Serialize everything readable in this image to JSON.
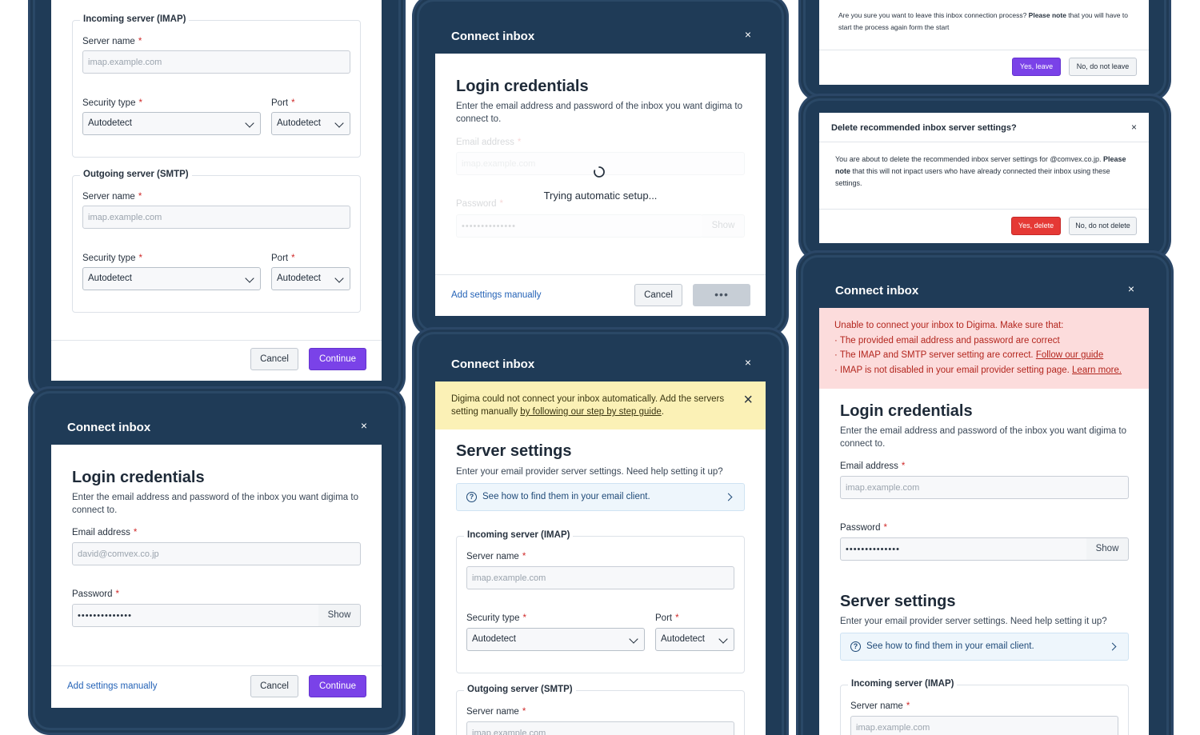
{
  "panel_a": {
    "imap_legend": "Incoming server (IMAP)",
    "smtp_legend": "Outgoing server (SMTP)",
    "server_name_label": "Server name",
    "server_name_placeholder": "imap.example.com",
    "security_type_label": "Security type",
    "security_type_value": "Autodetect",
    "port_label": "Port",
    "port_value": "Autodetect",
    "cancel": "Cancel",
    "continue": "Continue"
  },
  "panel_b": {
    "title": "Connect inbox",
    "heading": "Login credentials",
    "subtitle": "Enter the email address and password of the inbox you want digima to connect to.",
    "email_label": "Email address",
    "email_placeholder": "david@comvex.co.jp",
    "password_label": "Password",
    "password_value": "••••••••••••••",
    "show": "Show",
    "add_manually": "Add settings manually",
    "cancel": "Cancel",
    "continue": "Continue"
  },
  "panel_c": {
    "title": "Connect inbox",
    "heading": "Login credentials",
    "subtitle": "Enter the email address and password of the inbox you want digima to connect to.",
    "email_label": "Email address",
    "email_placeholder": "imap.example.com",
    "password_label": "Password",
    "password_value": "••••••••••••••",
    "show": "Show",
    "loading_text": "Trying automatic setup...",
    "add_manually": "Add settings manually",
    "cancel": "Cancel",
    "loading_dots": "•••"
  },
  "panel_d": {
    "title": "Connect inbox",
    "warning_text": "Digima could not connect your inbox automatically. Add the servers setting manually ",
    "warning_link": "by following our step by step guide",
    "warning_end": ".",
    "heading": "Server settings",
    "subtitle": "Enter your email provider server settings. Need help setting it up?",
    "help_text": "See how to find them in your email client.",
    "imap_legend": "Incoming server (IMAP)",
    "smtp_legend": "Outgoing server (SMTP)",
    "server_name_label": "Server name",
    "server_name_placeholder": "imap.example.com",
    "security_type_label": "Security type",
    "security_type_value": "Autodetect",
    "port_label": "Port",
    "port_value": "Autodetect"
  },
  "panel_e": {
    "text_prefix": "Are you sure you want to leave this inbox connection process? ",
    "text_bold": "Please note",
    "text_suffix": " that you will have to start the process again form the start",
    "yes": "Yes, leave",
    "no": "No, do not leave"
  },
  "panel_f": {
    "title": "Delete recommended inbox server settings?",
    "text_prefix": "You are about to delete the recommended inbox server settings for @comvex.co.jp. ",
    "text_bold": "Please note",
    "text_suffix": " that this will not inpact users who have already connected their inbox using these settings.",
    "yes": "Yes, delete",
    "no": "No, do not delete"
  },
  "panel_g": {
    "title": "Connect inbox",
    "error_intro": "Unable to connect your inbox to Digima. Make sure that:",
    "error_line1": "· The provided email address and password are correct",
    "error_line2": "· The IMAP and SMTP server setting are correct. ",
    "error_link2": "Follow our guide",
    "error_line3": "· IMAP is not disabled in your email provider setting page. ",
    "error_link3": "Learn more.",
    "heading": "Login credentials",
    "subtitle": "Enter the email address and password of the inbox you want digima to connect to.",
    "email_label": "Email address",
    "email_placeholder": "imap.example.com",
    "password_label": "Password",
    "password_value": "••••••••••••••",
    "show": "Show",
    "server_heading": "Server settings",
    "server_subtitle": "Enter your email provider server settings. Need help setting it up?",
    "help_text": "See how to find them in your email client.",
    "imap_legend": "Incoming server (IMAP)",
    "server_name_label": "Server name",
    "server_name_placeholder": "imap.example.com"
  },
  "common": {
    "close": "×",
    "required": "*",
    "help_icon": "?"
  },
  "colors": {
    "header": "#1f3b57",
    "primary": "#7a42e8",
    "danger": "#e53935",
    "warning_bg": "#fbf1b6",
    "error_bg": "#fcdcdc"
  }
}
